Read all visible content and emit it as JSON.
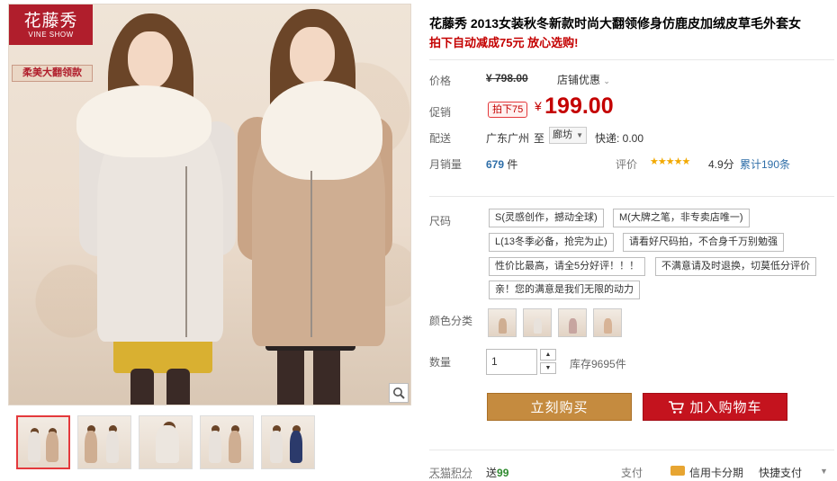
{
  "gallery": {
    "brand_logo_cn": "花藤秀",
    "brand_logo_en": "VINE SHOW",
    "promo_tag": "柔美大翻领款",
    "zoom_icon": "magnifier-icon",
    "thumbnail_count": 5,
    "active_thumbnail": 1
  },
  "product": {
    "title": "花藤秀 2013女装秋冬新款时尚大翻领修身仿鹿皮加绒皮草毛外套女",
    "subtitle": "拍下自动减成75元 放心选购!"
  },
  "price": {
    "label": "价格",
    "original": "¥ 798.00",
    "store_promo": "店铺优惠",
    "promo_label": "促销",
    "promo_badge": "拍下75",
    "currency": "¥",
    "promo_price": "199.00"
  },
  "shipping": {
    "label": "配送",
    "origin": "广东广州",
    "to": "至",
    "destination": "廊坊",
    "fee": "快递: 0.00"
  },
  "sales": {
    "label": "月销量",
    "count": "679",
    "unit": "件",
    "rating_label": "评价",
    "stars": "★★★★★",
    "rating": "4.9分",
    "reviews": "累计190条"
  },
  "size": {
    "label": "尺码",
    "options": [
      "S(灵感创作，撼动全球)",
      "M(大牌之笔，非专卖店唯一)",
      "L(13冬季必备，抢完为止)",
      "请看好尺码拍，不合身千万别勉强",
      "性价比最高，请全5分好评！！！",
      "不满意请及时退换，切莫低分评价",
      "亲！您的满意是我们无限的动力"
    ]
  },
  "color": {
    "label": "颜色分类",
    "option_count": 4
  },
  "quantity": {
    "label": "数量",
    "value": "1",
    "stock": "库存9695件"
  },
  "actions": {
    "buy_now": "立刻购买",
    "add_to_cart": "加入购物车"
  },
  "footer": {
    "points_label": "天猫积分",
    "points_prefix": "送",
    "points_value": "99",
    "pay_label": "支付",
    "credit_card": "信用卡分期",
    "quick_pay": "快捷支付"
  },
  "colors": {
    "accent_red": "#c40000",
    "buy_button": "#c58b3f",
    "cart_button": "#c4131e",
    "brand_red": "#b01e2c"
  }
}
